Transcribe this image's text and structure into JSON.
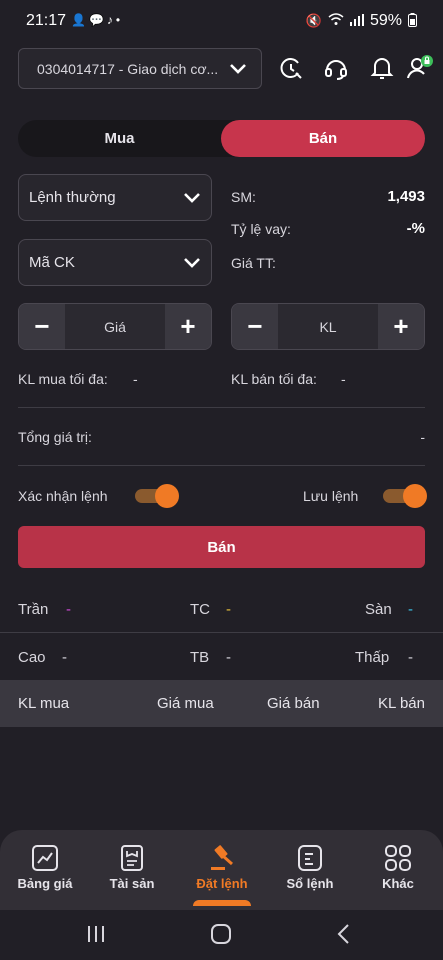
{
  "status_bar": {
    "time": "21:17",
    "battery": "59%"
  },
  "account": {
    "selected": "0304014717 - Giao dịch cơ..."
  },
  "side_tabs": {
    "buy": "Mua",
    "sell": "Bán"
  },
  "order_type": {
    "selected": "Lệnh thường"
  },
  "symbol": {
    "placeholder": "Mã CK"
  },
  "info": {
    "sm_label": "SM:",
    "sm_value": "1,493",
    "loan_label": "Tỷ lệ vay:",
    "loan_value": "-%",
    "market_price_label": "Giá TT:"
  },
  "price_stepper": {
    "minus": "−",
    "label": "Giá",
    "plus": "+"
  },
  "qty_stepper": {
    "minus": "−",
    "label": "KL",
    "plus": "+"
  },
  "limits": {
    "max_buy_label": "KL mua tối đa:",
    "max_buy_value": "-",
    "max_sell_label": "KL bán tối đa:",
    "max_sell_value": "-"
  },
  "total": {
    "label": "Tổng giá trị:",
    "value": "-"
  },
  "confirm_toggle": {
    "label": "Xác nhận lệnh",
    "on": true
  },
  "save_toggle": {
    "label": "Lưu lệnh",
    "on": true
  },
  "submit": {
    "label": "Bán"
  },
  "prices": {
    "ceiling_label": "Trần",
    "ceiling_value": "-",
    "ref_label": "TC",
    "ref_value": "-",
    "floor_label": "Sàn",
    "floor_value": "-",
    "high_label": "Cao",
    "high_value": "-",
    "avg_label": "TB",
    "avg_value": "-",
    "low_label": "Thấp",
    "low_value": "-"
  },
  "orderbook_header": {
    "buy_qty": "KL mua",
    "buy_price": "Giá mua",
    "sell_price": "Giá bán",
    "sell_qty": "KL bán"
  },
  "nav": [
    {
      "label": "Bảng giá"
    },
    {
      "label": "Tài sản"
    },
    {
      "label": "Đặt lệnh"
    },
    {
      "label": "Sổ lệnh"
    },
    {
      "label": "Khác"
    }
  ],
  "colors": {
    "accent": "#f07a25",
    "sell": "#c7354c",
    "ceiling": "#d14ad8",
    "ref": "#e8c03a",
    "floor": "#3ac4e8"
  }
}
